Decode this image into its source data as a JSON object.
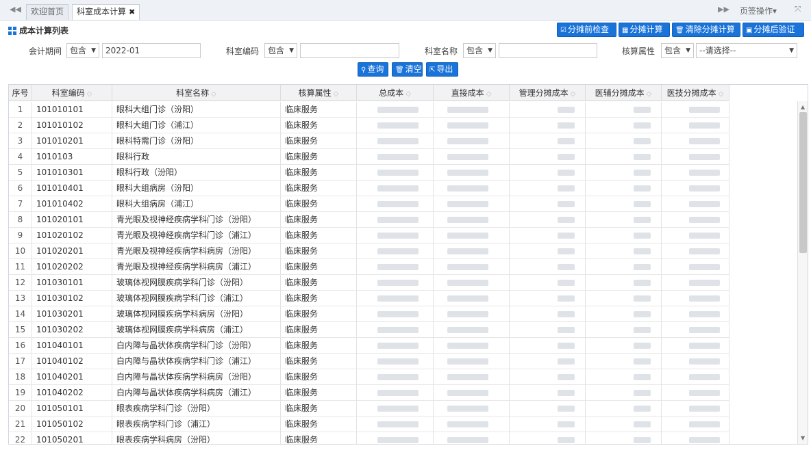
{
  "tabs": {
    "prev_icon": "double-left-arrow",
    "home": "欢迎首页",
    "active": "科室成本计算",
    "close": "✖",
    "next_icon": "double-right-arrow",
    "ops": "页签操作▾",
    "fullscreen_icon": "expand-arrows"
  },
  "panel": {
    "title": "成本计算列表"
  },
  "toolbar": {
    "pre_check": "分摊前检查",
    "calc": "分摊计算",
    "clear_calc": "清除分摊计算",
    "post_verify": "分摊后验证"
  },
  "filters": {
    "period_label": "会计期间",
    "period_op": "包含",
    "period_value": "2022-01",
    "code_label": "科室编码",
    "code_op": "包含",
    "code_value": "",
    "name_label": "科室名称",
    "name_op": "包含",
    "name_value": "",
    "attr_label": "核算属性",
    "attr_op": "包含",
    "attr_value": "--请选择--"
  },
  "actions": {
    "query": "查询",
    "clear": "清空",
    "export": "导出"
  },
  "table": {
    "headers": [
      "序号",
      "科室编码",
      "科室名称",
      "核算属性",
      "总成本",
      "直接成本",
      "管理分摊成本",
      "医辅分摊成本",
      "医技分摊成本"
    ],
    "rows": [
      {
        "no": "1",
        "code": "101010101",
        "name": "眼科大组门诊（汾阳）",
        "attr": "临床服务"
      },
      {
        "no": "2",
        "code": "101010102",
        "name": "眼科大组门诊（浦江）",
        "attr": "临床服务"
      },
      {
        "no": "3",
        "code": "101010201",
        "name": "眼科特需门诊（汾阳）",
        "attr": "临床服务"
      },
      {
        "no": "4",
        "code": "1010103",
        "name": "眼科行政",
        "attr": "临床服务"
      },
      {
        "no": "5",
        "code": "101010301",
        "name": "眼科行政（汾阳）",
        "attr": "临床服务"
      },
      {
        "no": "6",
        "code": "101010401",
        "name": "眼科大组病房（汾阳）",
        "attr": "临床服务"
      },
      {
        "no": "7",
        "code": "101010402",
        "name": "眼科大组病房（浦江）",
        "attr": "临床服务"
      },
      {
        "no": "8",
        "code": "101020101",
        "name": "青光眼及视神经疾病学科门诊（汾阳）",
        "attr": "临床服务"
      },
      {
        "no": "9",
        "code": "101020102",
        "name": "青光眼及视神经疾病学科门诊（浦江）",
        "attr": "临床服务"
      },
      {
        "no": "10",
        "code": "101020201",
        "name": "青光眼及视神经疾病学科病房（汾阳）",
        "attr": "临床服务"
      },
      {
        "no": "11",
        "code": "101020202",
        "name": "青光眼及视神经疾病学科病房（浦江）",
        "attr": "临床服务"
      },
      {
        "no": "12",
        "code": "101030101",
        "name": "玻璃体视网膜疾病学科门诊（汾阳）",
        "attr": "临床服务"
      },
      {
        "no": "13",
        "code": "101030102",
        "name": "玻璃体视网膜疾病学科门诊（浦江）",
        "attr": "临床服务"
      },
      {
        "no": "14",
        "code": "101030201",
        "name": "玻璃体视网膜疾病学科病房（汾阳）",
        "attr": "临床服务"
      },
      {
        "no": "15",
        "code": "101030202",
        "name": "玻璃体视网膜疾病学科病房（浦江）",
        "attr": "临床服务"
      },
      {
        "no": "16",
        "code": "101040101",
        "name": "白内障与晶状体疾病学科门诊（汾阳）",
        "attr": "临床服务"
      },
      {
        "no": "17",
        "code": "101040102",
        "name": "白内障与晶状体疾病学科门诊（浦江）",
        "attr": "临床服务"
      },
      {
        "no": "18",
        "code": "101040201",
        "name": "白内障与晶状体疾病学科病房（汾阳）",
        "attr": "临床服务"
      },
      {
        "no": "19",
        "code": "101040202",
        "name": "白内障与晶状体疾病学科病房（浦江）",
        "attr": "临床服务"
      },
      {
        "no": "20",
        "code": "101050101",
        "name": "眼表疾病学科门诊（汾阳）",
        "attr": "临床服务"
      },
      {
        "no": "21",
        "code": "101050102",
        "name": "眼表疾病学科门诊（浦江）",
        "attr": "临床服务"
      },
      {
        "no": "22",
        "code": "101050201",
        "name": "眼表疾病学科病房（汾阳）",
        "attr": "临床服务"
      }
    ]
  },
  "icons": {
    "list_icon": "grid-icon",
    "check_icon": "check-square-icon",
    "calc_icon": "calculator-icon",
    "trash_icon": "trash-icon",
    "verify_icon": "verify-icon",
    "search_icon": "search-icon",
    "export_icon": "export-icon"
  },
  "colors": {
    "accent": "#1a73d9"
  }
}
